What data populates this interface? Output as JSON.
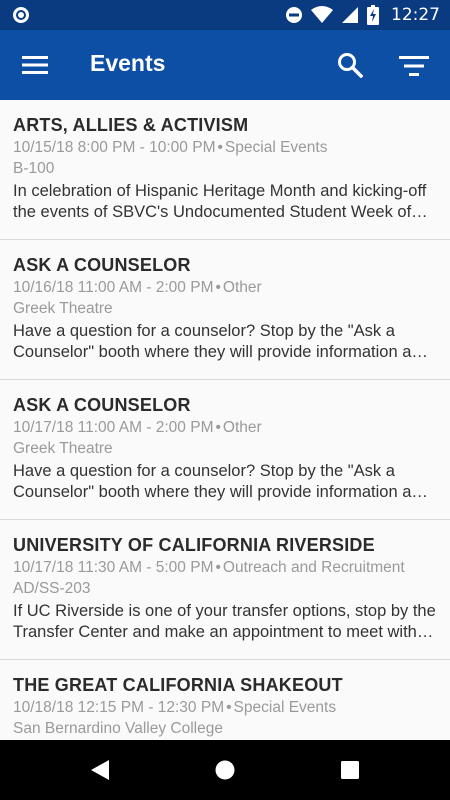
{
  "status_bar": {
    "time": "12:27",
    "icons": [
      "app-notification-icon",
      "do-not-disturb-icon",
      "wifi-icon",
      "signal-icon",
      "battery-charging-icon"
    ]
  },
  "app_bar": {
    "title": "Events",
    "color": "#0e4fa6",
    "icons": [
      "menu-icon",
      "search-icon",
      "filter-icon"
    ]
  },
  "events": [
    {
      "title": "ARTS, ALLIES & ACTIVISM",
      "datetime": "10/15/18 8:00 PM - 10:00 PM",
      "category": "Special Events",
      "location": "B-100",
      "description": "In celebration of Hispanic Heritage Month and kicking-off the events of SBVC's Undocumented Student Week of Action"
    },
    {
      "title": "ASK A COUNSELOR",
      "datetime": "10/16/18 11:00 AM - 2:00 PM",
      "category": "Other",
      "location": "Greek Theatre",
      "description": "Have a question for a counselor? Stop by the \"Ask a Counselor\" booth where they will provide information and answer questions"
    },
    {
      "title": "ASK A COUNSELOR",
      "datetime": "10/17/18 11:00 AM - 2:00 PM",
      "category": "Other",
      "location": "Greek Theatre",
      "description": "Have a question for a counselor? Stop by the \"Ask a Counselor\" booth where they will provide information and answer questions"
    },
    {
      "title": "UNIVERSITY OF CALIFORNIA RIVERSIDE",
      "datetime": "10/17/18 11:30 AM - 5:00 PM",
      "category": "Outreach and Recruitment",
      "location": "AD/SS-203",
      "description": "If UC Riverside is one of your transfer options, stop by the Transfer Center and make an appointment to meet with a representative"
    },
    {
      "title": "THE GREAT CALIFORNIA SHAKEOUT",
      "datetime": "10/18/18 12:15 PM - 12:30 PM",
      "category": "Special Events",
      "location": "San Bernardino Valley College",
      "description": ""
    }
  ],
  "nav_bar": {
    "icons": [
      "back-icon",
      "home-icon",
      "recents-icon"
    ]
  }
}
